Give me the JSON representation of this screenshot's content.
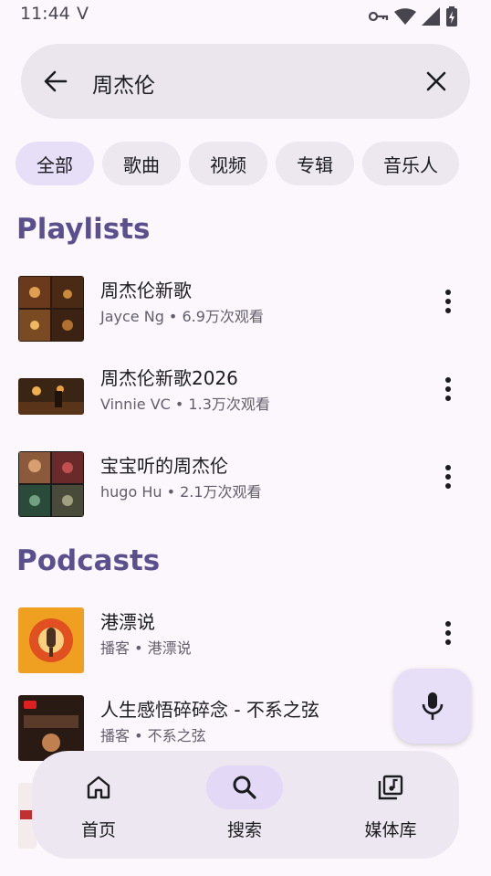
{
  "status": {
    "time": "11:44",
    "carrier_glyph": "V"
  },
  "search": {
    "query": "周杰伦"
  },
  "chips": [
    "全部",
    "歌曲",
    "视频",
    "专辑",
    "音乐人"
  ],
  "sections": {
    "playlists": {
      "title": "Playlists",
      "items": [
        {
          "title": "周杰伦新歌",
          "subtitle": "Jayce Ng • 6.9万次观看"
        },
        {
          "title": "周杰伦新歌2026",
          "subtitle": "Vinnie VC • 1.3万次观看"
        },
        {
          "title": "宝宝听的周杰伦",
          "subtitle": "hugo Hu • 2.1万次观看"
        }
      ]
    },
    "podcasts": {
      "title": "Podcasts",
      "items": [
        {
          "title": "港漂说",
          "subtitle": "播客 • 港漂说"
        },
        {
          "title": "人生感悟碎碎念 - 不系之弦",
          "subtitle": "播客 • 不系之弦"
        }
      ]
    }
  },
  "nav": [
    {
      "label": "首页",
      "icon": "home-icon"
    },
    {
      "label": "搜索",
      "icon": "search-icon"
    },
    {
      "label": "媒体库",
      "icon": "library-music-icon"
    }
  ],
  "colors": {
    "accent": "#5b4f8d",
    "chip_active": "#e7def8",
    "background": "#fcf7fd"
  }
}
